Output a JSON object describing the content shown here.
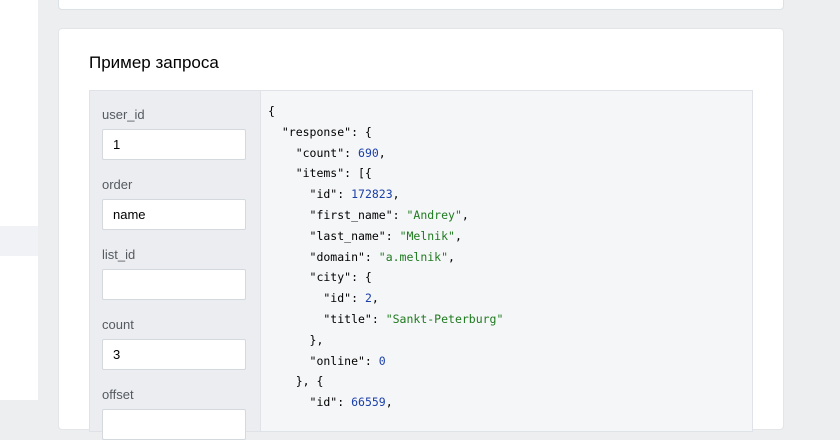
{
  "section": {
    "title": "Пример запроса"
  },
  "params": [
    {
      "label": "user_id",
      "value": "1"
    },
    {
      "label": "order",
      "value": "name"
    },
    {
      "label": "list_id",
      "value": ""
    },
    {
      "label": "count",
      "value": "3"
    },
    {
      "label": "offset",
      "value": ""
    }
  ],
  "response": {
    "count": "690",
    "items": [
      {
        "id": "172823",
        "first_name": "\"Andrey\"",
        "last_name": "\"Melnik\"",
        "domain": "\"a.melnik\"",
        "city_id": "2",
        "city_title": "\"Sankt-Peterburg\"",
        "online": "0"
      }
    ],
    "next_id_partial": "66559"
  },
  "colors": {
    "string": "#1f7a1f",
    "number": "#1a3fa8",
    "background": "#edeef0"
  }
}
